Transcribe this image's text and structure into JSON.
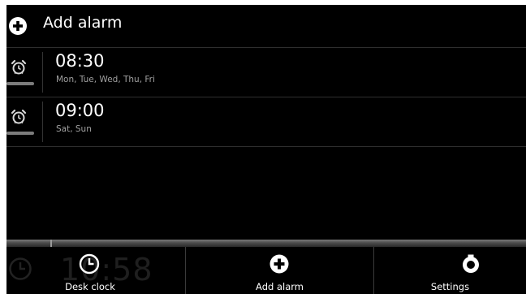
{
  "header": {
    "title": "Add alarm",
    "icon": "plus-circle-icon"
  },
  "alarms": [
    {
      "time": "08:30",
      "days": "Mon, Tue, Wed, Thu, Fri",
      "icon": "alarm-clock-icon",
      "enabled": true
    },
    {
      "time": "09:00",
      "days": "Sat, Sun",
      "icon": "alarm-clock-icon",
      "enabled": true
    }
  ],
  "background_clock": {
    "time": "10:58"
  },
  "bottom_bar": {
    "desk_clock": {
      "label": "Desk clock",
      "icon": "clock-icon"
    },
    "add_alarm": {
      "label": "Add alarm",
      "icon": "plus-circle-icon"
    },
    "settings": {
      "label": "Settings",
      "icon": "settings-icon"
    }
  }
}
